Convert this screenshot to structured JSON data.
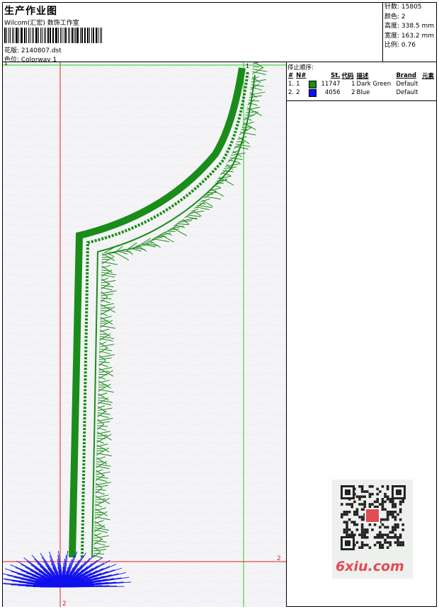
{
  "header": {
    "title": "生产作业图",
    "subtitle": "Wilcom(汇宏) 数饰工作室",
    "design_label": "花版: 2140807.dst",
    "colorway_label": "色位: Colorway 1"
  },
  "stats": [
    "针数: 15805",
    "颜色: 2",
    "高度: 338.5 mm",
    "宽度: 163.2 mm",
    "比例: 0.76"
  ],
  "stop_sequence": {
    "caption": "停止顺序:",
    "headers": [
      "#",
      "N#",
      "St.",
      "代码",
      "描述",
      "Brand",
      "元素"
    ],
    "rows": [
      {
        "num": "1.",
        "n": "1",
        "color": "#1a8c1a",
        "stitches": "11747",
        "code": "1",
        "desc": "Dark Green",
        "brand": "Default"
      },
      {
        "num": "2.",
        "n": "2",
        "color": "#1010ee",
        "stitches": "4056",
        "code": "2",
        "desc": "Blue",
        "brand": "Default"
      }
    ]
  },
  "markers": {
    "start": "1",
    "end": "2",
    "corner_end": "2"
  },
  "watermark": {
    "logo_text": "6xiu.com"
  },
  "colors": {
    "green_thread": "#1a8c1a",
    "blue_thread": "#1010ee",
    "guide_red": "#e02020",
    "guide_green": "#22cc22"
  }
}
